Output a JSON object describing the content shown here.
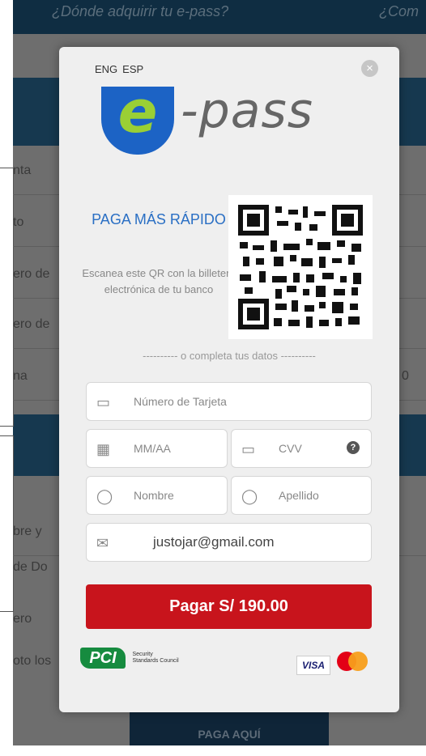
{
  "background": {
    "top_links": [
      "¿Dónde adquirir tu e-pass?",
      "¿Com"
    ],
    "rows": [
      "nta",
      "to",
      "ero de",
      "ero de",
      "na",
      "bre y",
      "de Do",
      "ero",
      "oto los"
    ],
    "right_value": "0",
    "button_label": "PAGA AQUÍ"
  },
  "modal": {
    "lang": {
      "eng": "ENG",
      "esp": "ESP"
    },
    "close_symbol": "×",
    "logo": {
      "letter": "e",
      "text": "-pass"
    },
    "qr": {
      "title": "PAGA MÁS RÁPIDO",
      "description": "Escanea este QR con la billetera electrónica de tu banco"
    },
    "divider": "---------- o completa tus datos ----------",
    "fields": {
      "card_number": "Número de Tarjeta",
      "expiry": "MM/AA",
      "cvv": "CVV",
      "first_name": "Nombre",
      "last_name": "Apellido",
      "email": "justojar@gmail.com"
    },
    "help_symbol": "?",
    "pay_button": "Pagar S/ 190.00",
    "pci": {
      "mark": "PCI",
      "text_line1": "Security",
      "text_line2": "Standards Council"
    },
    "visa": "VISA",
    "accent": "#c8141c"
  }
}
